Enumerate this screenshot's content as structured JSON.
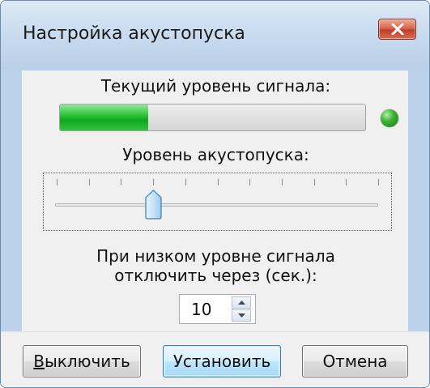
{
  "window": {
    "title": "Настройка акустопуска"
  },
  "signal": {
    "label": "Текущий уровень сигнала:",
    "level_percent": 29,
    "indicator_color": "#2e9e2a"
  },
  "threshold": {
    "label": "Уровень акустопуска:",
    "tick_count": 11,
    "position_index": 3
  },
  "timeout": {
    "label_line1": "При низком уровне сигнала",
    "label_line2": "отключить через (сек.):",
    "value": "10"
  },
  "buttons": {
    "off_mnemonic": "В",
    "off_rest": "ыключить",
    "set_label": "Установить",
    "cancel_label": "Отмена"
  },
  "icons": {
    "close": "close-icon",
    "spin_up": "arrow-up-icon",
    "spin_down": "arrow-down-icon",
    "led": "status-led-icon"
  }
}
